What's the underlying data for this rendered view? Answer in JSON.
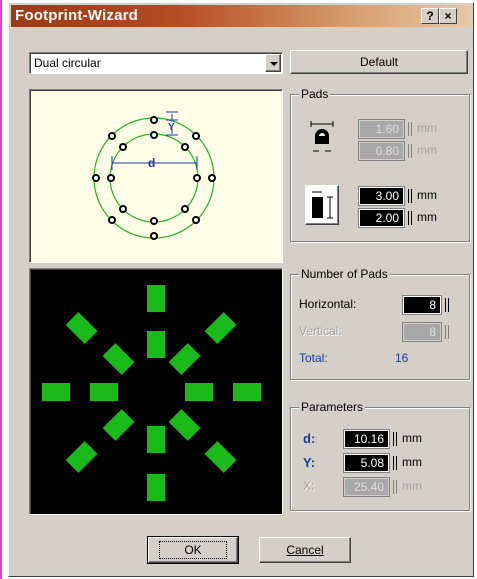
{
  "window": {
    "title": "Footprint-Wizard",
    "help_label": "?",
    "close_label": "×"
  },
  "shape_select": {
    "value": "Dual circular"
  },
  "default_button": {
    "label": "Default"
  },
  "preview": {
    "d_label": "d",
    "y_label": "Y"
  },
  "pads": {
    "group_label": "Pads",
    "hole_outer": {
      "value": "1.60",
      "unit": "mm"
    },
    "hole_inner": {
      "value": "0.80",
      "unit": "mm"
    },
    "pad_width": {
      "value": "3.00",
      "unit": "mm"
    },
    "pad_height": {
      "value": "2.00",
      "unit": "mm"
    }
  },
  "num_pads": {
    "group_label": "Number of Pads",
    "horizontal_label": "Horizontal:",
    "horizontal_value": "8",
    "vertical_label": "Vertical:",
    "vertical_value": "8",
    "total_label": "Total:",
    "total_value": "16"
  },
  "params": {
    "group_label": "Parameters",
    "d_label": "d:",
    "d_value": "10.16",
    "y_label": "Y:",
    "y_value": "5.08",
    "x_label": "X:",
    "x_value": "25.40",
    "unit": "mm"
  },
  "footer": {
    "ok_label": "OK",
    "cancel_label": "Cancel"
  },
  "colors": {
    "pad_green": "#1aba1a",
    "title_red": "#9c3a18"
  }
}
